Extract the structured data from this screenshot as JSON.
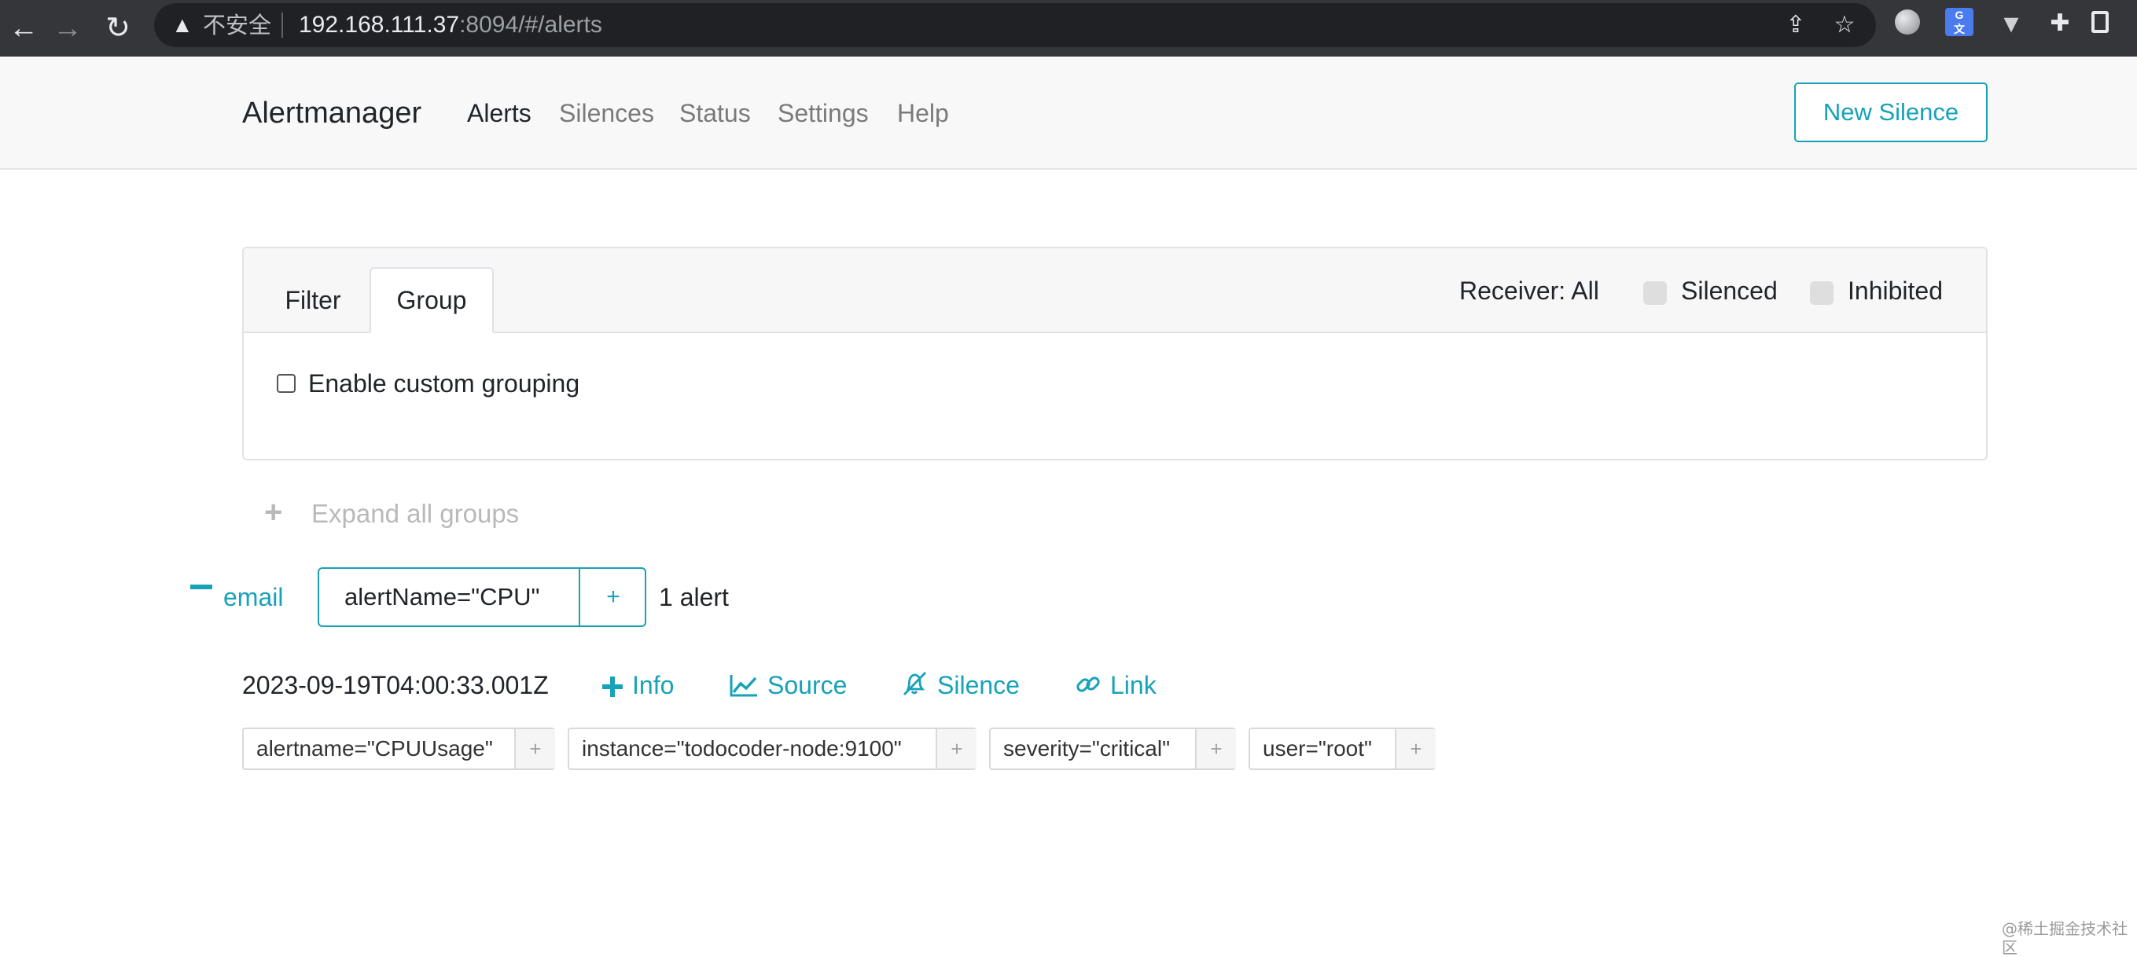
{
  "browser": {
    "security_warning": "不安全",
    "url_host": "192.168.111.37",
    "url_rest": ":8094/#/alerts"
  },
  "navbar": {
    "brand": "Alertmanager",
    "links": [
      "Alerts",
      "Silences",
      "Status",
      "Settings",
      "Help"
    ],
    "active_link": "Alerts",
    "new_silence": "New Silence"
  },
  "filter_card": {
    "tabs": [
      "Filter",
      "Group"
    ],
    "active_tab": "Group",
    "receiver": "Receiver: All",
    "silenced": "Silenced",
    "inhibited": "Inhibited",
    "custom_grouping": "Enable custom grouping"
  },
  "expand_all": "Expand all groups",
  "group": {
    "receiver": "email",
    "label": "alertName=\"CPU\"",
    "add": "+",
    "count": "1 alert"
  },
  "alert": {
    "timestamp": "2023-09-19T04:00:33.001Z",
    "actions": {
      "info": "Info",
      "source": "Source",
      "silence": "Silence",
      "link": "Link"
    },
    "labels": [
      "alertname=\"CPUUsage\"",
      "instance=\"todocoder-node:9100\"",
      "severity=\"critical\"",
      "user=\"root\""
    ],
    "label_add": "+"
  },
  "watermark": "@稀土掘金技术社区",
  "colors": {
    "accent": "#17a2b8",
    "text": "#212529",
    "muted": "#7a7a7a"
  }
}
